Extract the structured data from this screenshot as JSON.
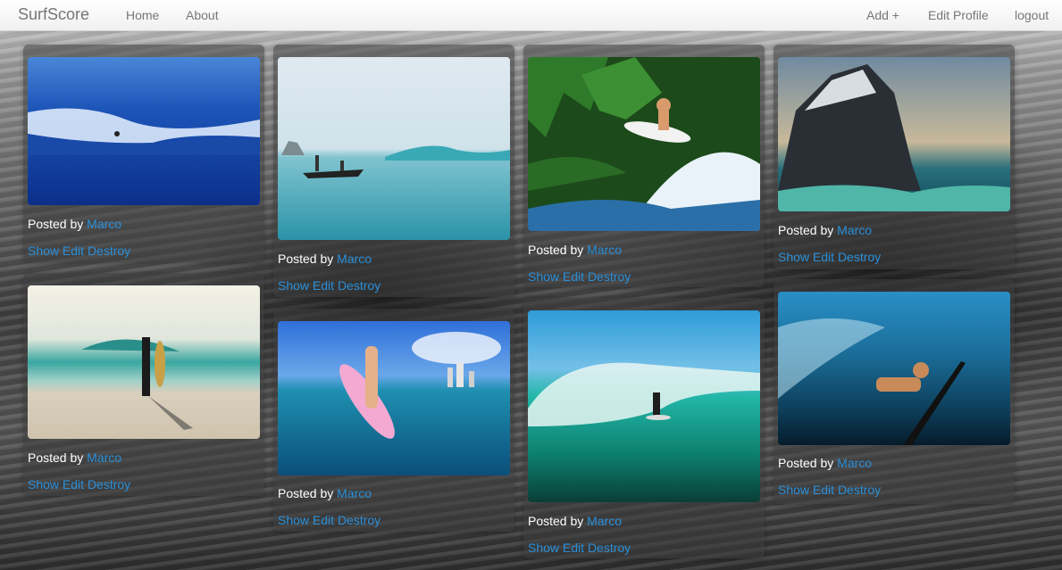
{
  "navbar": {
    "brand": "SurfScore",
    "home": "Home",
    "about": "About",
    "add": "Add +",
    "edit_profile": "Edit Profile",
    "logout": "logout"
  },
  "pins": [
    {
      "posted_by": "Posted by",
      "author": "Marco",
      "show": "Show",
      "edit": "Edit",
      "destroy": "Destroy"
    },
    {
      "posted_by": "Posted by",
      "author": "Marco",
      "show": "Show",
      "edit": "Edit",
      "destroy": "Destroy"
    },
    {
      "posted_by": "Posted by",
      "author": "Marco",
      "show": "Show",
      "edit": "Edit",
      "destroy": "Destroy"
    },
    {
      "posted_by": "Posted by",
      "author": "Marco",
      "show": "Show",
      "edit": "Edit",
      "destroy": "Destroy"
    },
    {
      "posted_by": "Posted by",
      "author": "Marco",
      "show": "Show",
      "edit": "Edit",
      "destroy": "Destroy"
    },
    {
      "posted_by": "Posted by",
      "author": "Marco",
      "show": "Show",
      "edit": "Edit",
      "destroy": "Destroy"
    },
    {
      "posted_by": "Posted by",
      "author": "Marco",
      "show": "Show",
      "edit": "Edit",
      "destroy": "Destroy"
    },
    {
      "posted_by": "Posted by",
      "author": "Marco",
      "show": "Show",
      "edit": "Edit",
      "destroy": "Destroy"
    }
  ],
  "colors": {
    "link": "#2a8fd8",
    "navbar_bg": "#f5f5f5",
    "card_bg": "rgba(60,60,60,0.55)"
  }
}
